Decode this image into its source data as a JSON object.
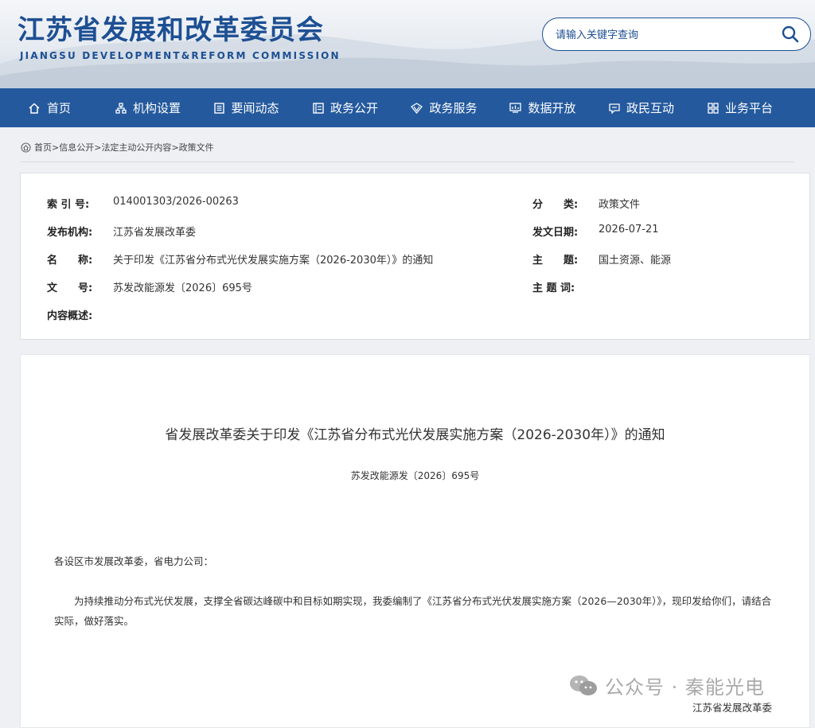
{
  "header": {
    "title": "江苏省发展和改革委员会",
    "subtitle": "JIANGSU DEVELOPMENT&REFORM COMMISSION",
    "search_placeholder": "请输入关键字查询"
  },
  "nav": [
    {
      "label": "首页",
      "icon": "home-icon"
    },
    {
      "label": "机构设置",
      "icon": "org-chart-icon"
    },
    {
      "label": "要闻动态",
      "icon": "news-icon"
    },
    {
      "label": "政务公开",
      "icon": "document-icon"
    },
    {
      "label": "政务服务",
      "icon": "service-icon"
    },
    {
      "label": "数据开放",
      "icon": "data-icon"
    },
    {
      "label": "政民互动",
      "icon": "chat-icon"
    },
    {
      "label": "业务平台",
      "icon": "grid-icon"
    }
  ],
  "breadcrumb": {
    "items": [
      "首页",
      "信息公开",
      "法定主动公开内容"
    ],
    "separator": ">",
    "current": "政策文件"
  },
  "meta": {
    "index_label": "索 引 号:",
    "index_value": "014001303/2026-00263",
    "category_label": "分　　类:",
    "category_value": "政策文件",
    "publisher_label": "发布机构:",
    "publisher_value": "江苏省发展改革委",
    "date_label": "发文日期:",
    "date_value": "2026-07-21",
    "name_label": "名　　称:",
    "name_value": "关于印发《江苏省分布式光伏发展实施方案（2026-2030年）》的通知",
    "topic_label": "主　　题:",
    "topic_value": "国土资源、能源",
    "docno_label": "文　　号:",
    "docno_value": "苏发改能源发〔2026〕695号",
    "keywords_label": "主 题 词:",
    "keywords_value": "",
    "summary_label": "内容概述:",
    "summary_value": ""
  },
  "article": {
    "title": "省发展改革委关于印发《江苏省分布式光伏发展实施方案（2026-2030年）》的通知",
    "doc_number": "苏发改能源发〔2026〕695号",
    "salutation": "各设区市发展改革委，省电力公司：",
    "body": "为持续推动分布式光伏发展，支撑全省碳达峰碳中和目标如期实现，我委编制了《江苏省分布式光伏发展实施方案（2026—2030年）》，现印发给你们，请结合实际，做好落实。",
    "signer": "江苏省发展改革委"
  },
  "watermark": {
    "text": "公众号 · 秦能光电",
    "icon": "wechat-icon"
  },
  "colors": {
    "brand": "#1d4f93",
    "nav_bg": "#24599d"
  }
}
